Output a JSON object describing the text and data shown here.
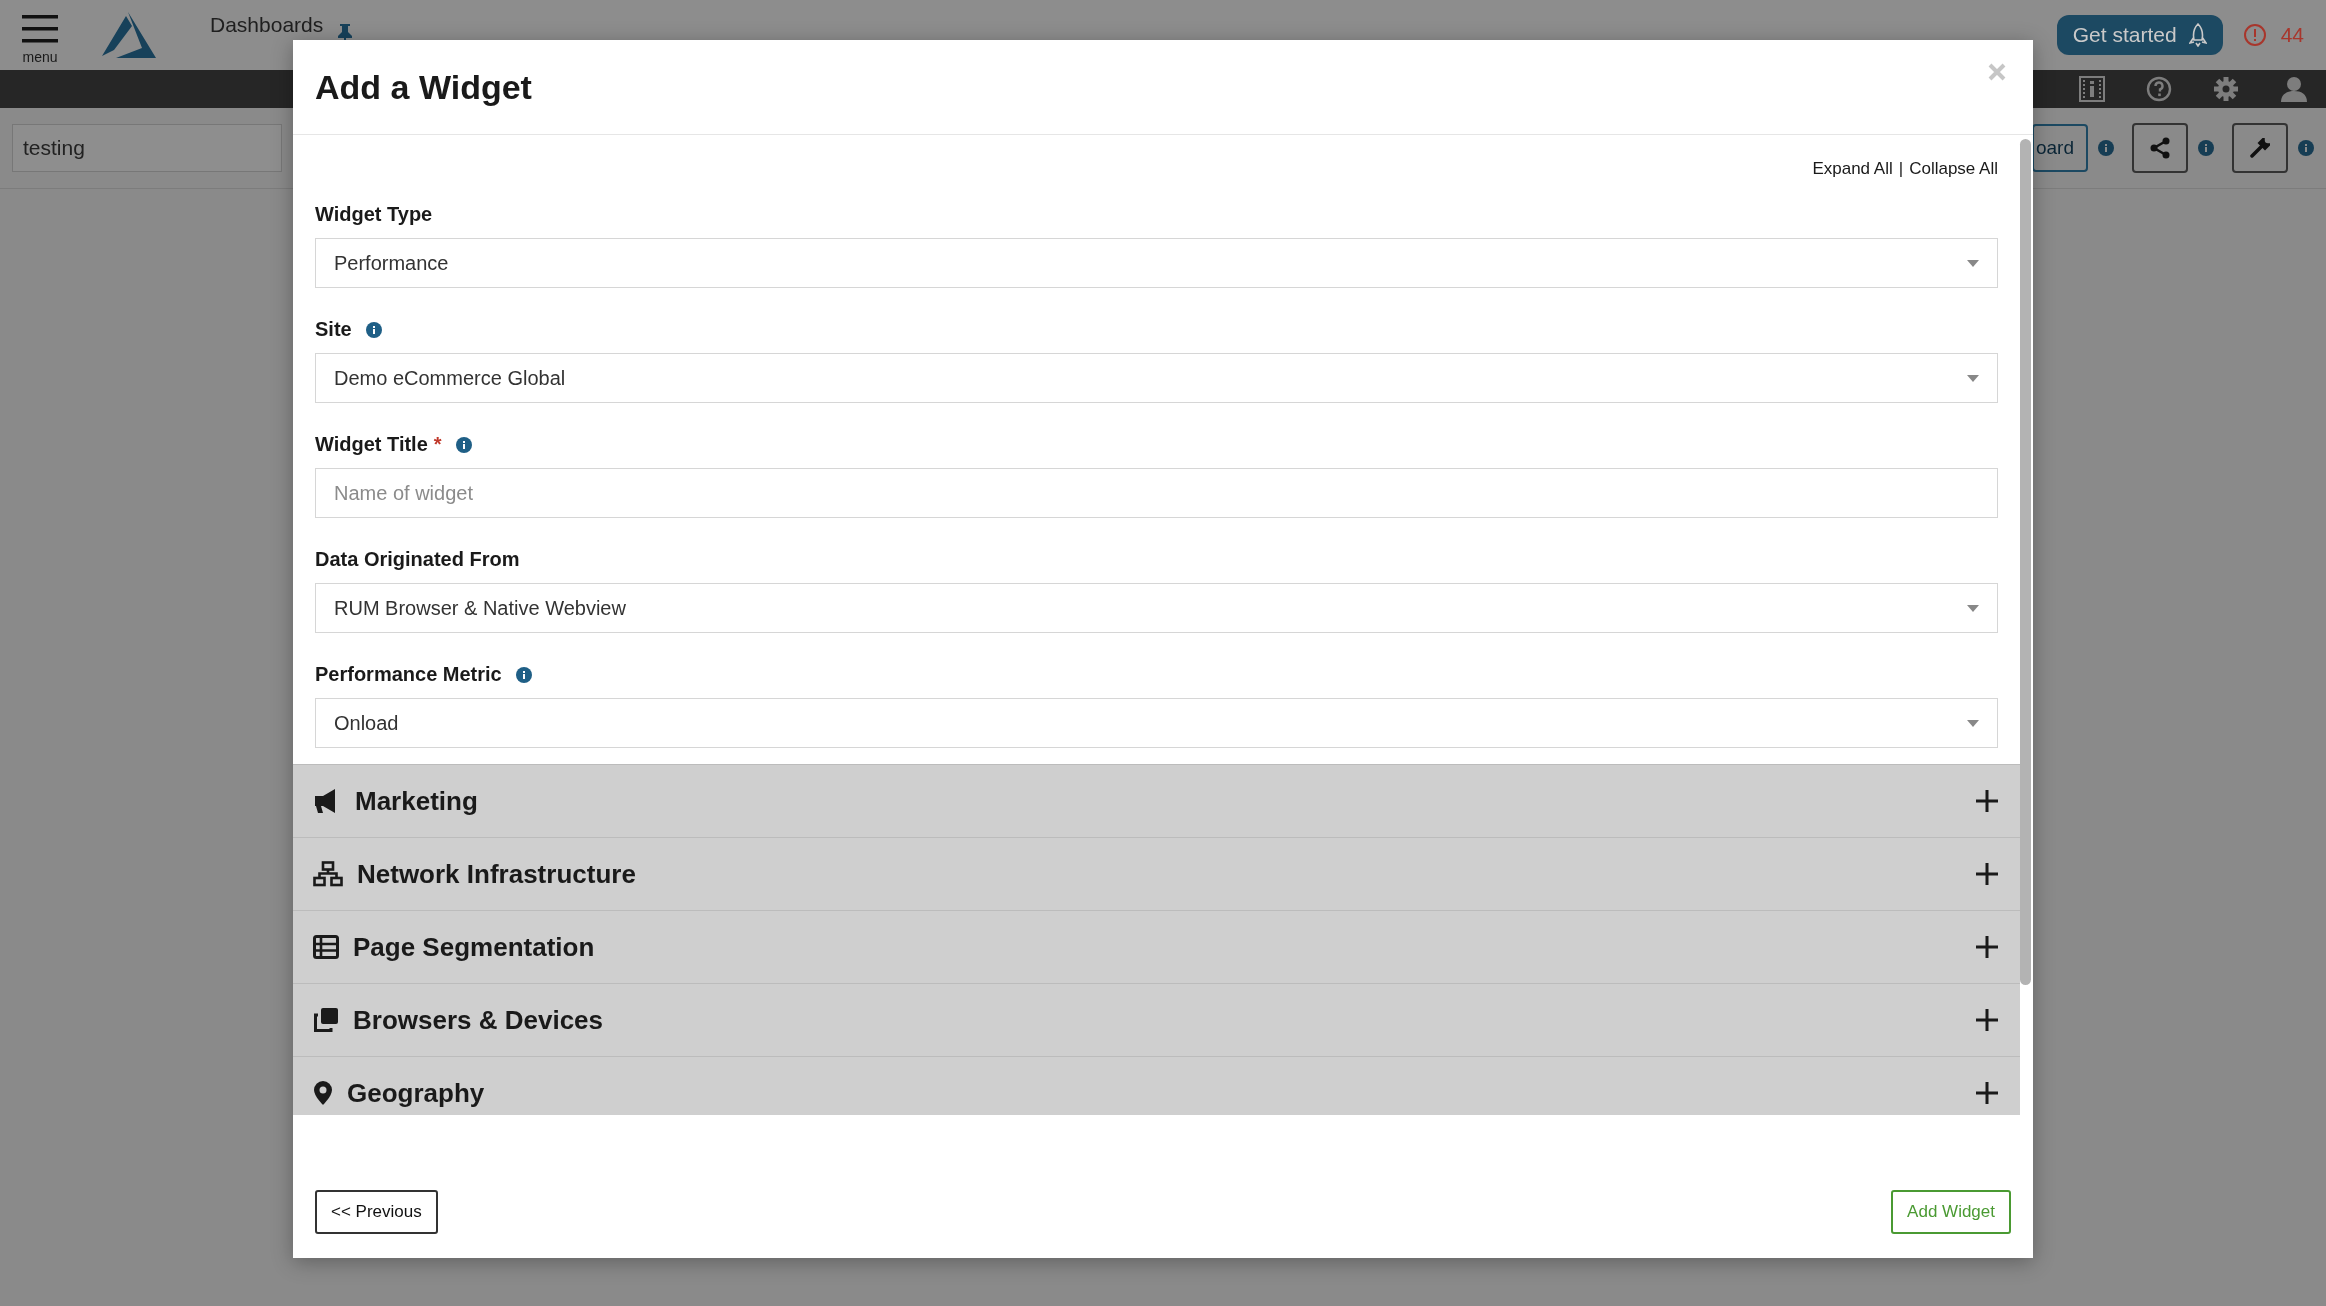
{
  "app_bar": {
    "menu_label": "menu",
    "breadcrumb": "Dashboards",
    "get_started": "Get started",
    "alert_count": "44"
  },
  "toolbar": {
    "dashboard_name": "testing",
    "partial_button": "oard"
  },
  "modal": {
    "title": "Add a Widget",
    "expand_all": "Expand All",
    "separator": "|",
    "collapse_all": "Collapse All",
    "fields": [
      {
        "label": "Widget Type",
        "info": false,
        "kind": "select",
        "value": "Performance"
      },
      {
        "label": "Site",
        "info": true,
        "kind": "select",
        "value": "Demo eCommerce Global"
      },
      {
        "label": "Widget Title",
        "required_mark": "*",
        "info": true,
        "kind": "text",
        "placeholder": "Name of widget"
      },
      {
        "label": "Data Originated From",
        "info": false,
        "kind": "select",
        "value": "RUM Browser & Native Webview"
      },
      {
        "label": "Performance Metric",
        "info": true,
        "kind": "select",
        "value": "Onload"
      }
    ],
    "sections": [
      {
        "title": "Marketing",
        "expanded": false
      },
      {
        "title": "Network Infrastructure",
        "expanded": false
      },
      {
        "title": "Page Segmentation",
        "expanded": false
      },
      {
        "title": "Browsers & Devices",
        "expanded": false
      },
      {
        "title": "Geography",
        "expanded": false
      }
    ],
    "previous_button": "<< Previous",
    "add_button": "Add Widget"
  }
}
